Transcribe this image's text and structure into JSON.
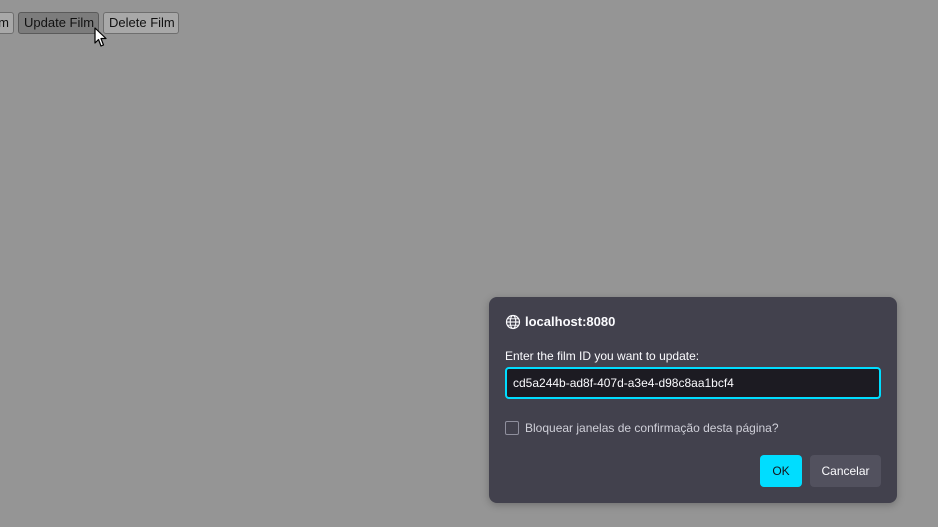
{
  "page": {
    "buttons": {
      "partial_label": "m",
      "update_label": "Update Film",
      "delete_label": "Delete Film"
    }
  },
  "dialog": {
    "origin": "localhost:8080",
    "origin_icon": "globe-icon",
    "message": "Enter the film ID you want to update:",
    "input_value": "cd5a244b-ad8f-407d-a3e4-d98c8aa1bcf4",
    "checkbox_label": "Bloquear janelas de confirmação desta página?",
    "checkbox_checked": false,
    "ok_label": "OK",
    "cancel_label": "Cancelar"
  },
  "colors": {
    "overlay_background": "#959595",
    "dialog_background": "#42414d",
    "accent": "#00ddff"
  }
}
